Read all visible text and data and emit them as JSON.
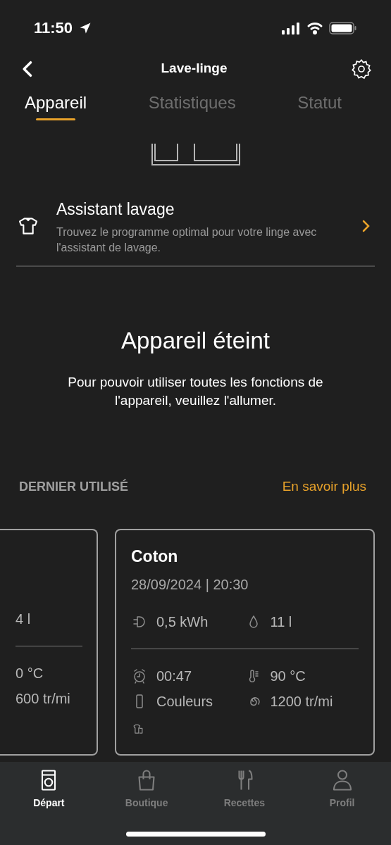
{
  "status_bar": {
    "time": "11:50"
  },
  "header": {
    "title": "Lave-linge"
  },
  "tabs": [
    {
      "label": "Appareil",
      "selected": true
    },
    {
      "label": "Statistiques",
      "selected": false
    },
    {
      "label": "Statut",
      "selected": false
    }
  ],
  "assistant": {
    "title": "Assistant lavage",
    "description": "Trouvez le programme optimal pour votre linge avec l'assistant de lavage."
  },
  "notice": {
    "title": "Appareil éteint",
    "text": "Pour pouvoir utiliser toutes les fonctions de l'appareil, veuillez l'allumer."
  },
  "last_used": {
    "heading": "DERNIER UTILISÉ",
    "link": "En savoir plus",
    "cards": [
      {
        "kind": "partial",
        "water": "4 l",
        "temperature": "0 °C",
        "spin": "600 tr/mi"
      },
      {
        "kind": "full",
        "name": "Coton",
        "date": "28/09/2024 | 20:30",
        "energy": "0,5 kWh",
        "water": "11 l",
        "duration": "00:47",
        "temperature": "90 °C",
        "laundry": "Couleurs",
        "spin": "1200 tr/mi"
      }
    ]
  },
  "bottom_nav": [
    {
      "label": "Départ",
      "selected": true
    },
    {
      "label": "Boutique",
      "selected": false
    },
    {
      "label": "Recettes",
      "selected": false
    },
    {
      "label": "Profil",
      "selected": false
    }
  ]
}
